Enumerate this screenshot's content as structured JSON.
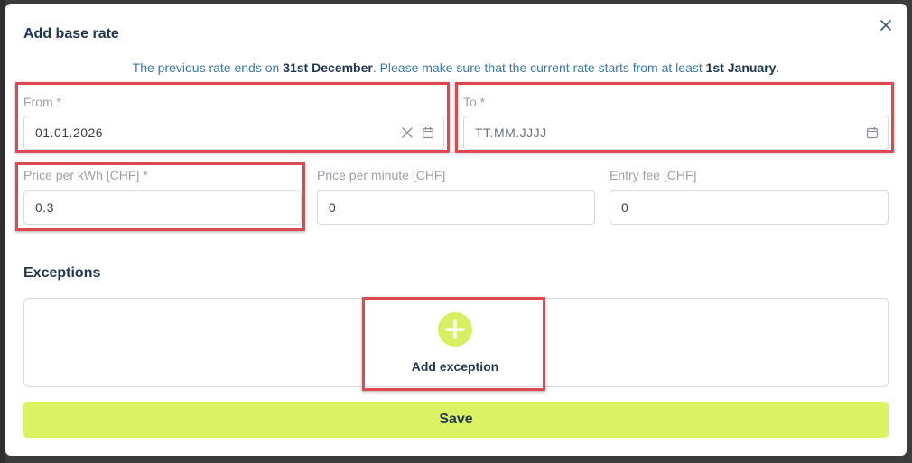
{
  "dialog": {
    "title": "Add base rate",
    "notice_prefix": "The previous rate ends on ",
    "notice_date_end": "31st December",
    "notice_middle": ". Please make sure that the current rate starts from at least ",
    "notice_date_start": "1st January",
    "notice_suffix": "."
  },
  "form": {
    "from": {
      "label": "From *",
      "value": "01.01.2026"
    },
    "to": {
      "label": "To *",
      "placeholder": "TT.MM.JJJJ"
    },
    "price_kwh": {
      "label": "Price per kWh [CHF] *",
      "value": "0.3"
    },
    "price_minute": {
      "label": "Price per minute [CHF]",
      "value": "0"
    },
    "entry_fee": {
      "label": "Entry fee [CHF]",
      "value": "0"
    }
  },
  "exceptions": {
    "title": "Exceptions",
    "add_label": "Add exception"
  },
  "actions": {
    "save_label": "Save"
  },
  "colors": {
    "accent": "#dbf262",
    "title_text": "#1f3550",
    "notice_text": "#3e78a6",
    "highlight": "#e0484f"
  }
}
